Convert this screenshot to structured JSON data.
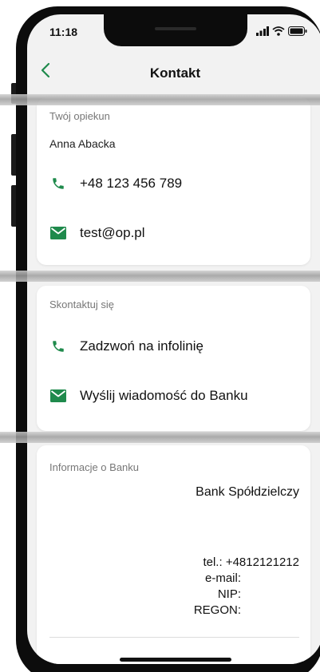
{
  "status_bar": {
    "time": "11:18",
    "icons": [
      "signal-icon",
      "wifi-icon",
      "battery-icon"
    ]
  },
  "header": {
    "back_icon": "chevron-left-icon",
    "title": "Kontakt"
  },
  "caretaker": {
    "label": "Twój opiekun",
    "name": "Anna Abacka",
    "phone": "+48 123 456 789",
    "email": "test@op.pl"
  },
  "contact": {
    "label": "Skontaktuj się",
    "call": "Zadzwoń na infolinię",
    "message": "Wyślij wiadomość do Banku"
  },
  "bank_info": {
    "label": "Informacje o Banku",
    "name": "Bank Spółdzielczy",
    "tel": "tel.: +4812121212",
    "email": "e-mail:",
    "nip": "NIP:",
    "regon": "REGON:"
  },
  "colors": {
    "accent": "#1f8a4c",
    "screen_bg": "#f2f2f2",
    "card_bg": "#ffffff"
  }
}
